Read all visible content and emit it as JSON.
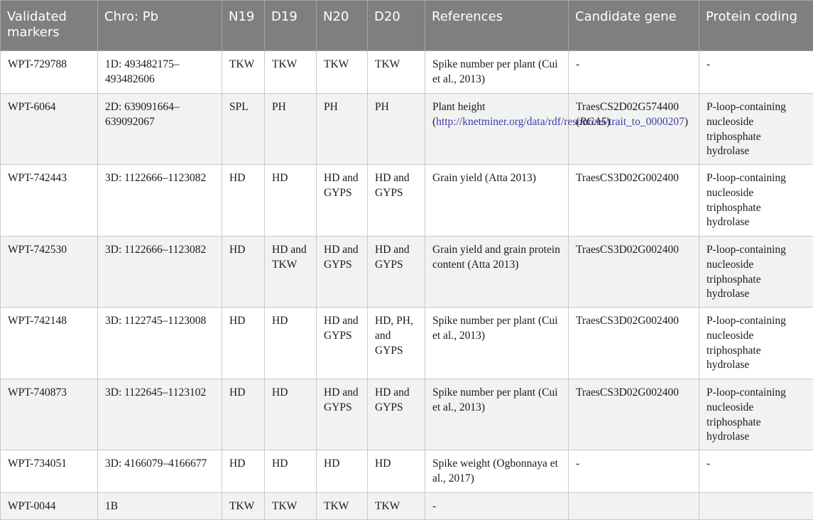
{
  "table": {
    "headers": [
      "Validated markers",
      "Chro: Pb",
      "N19",
      "D19",
      "N20",
      "D20",
      "References",
      "Candidate gene",
      "Protein coding"
    ],
    "rows": [
      {
        "marker": "WPT-729788",
        "chro": "1D: 493482175–493482606",
        "n19": "TKW",
        "d19": "TKW",
        "n20": "TKW",
        "d20": "TKW",
        "reference": "Spike number per plant (Cui et al., 2013)",
        "gene": "-",
        "protein": "-"
      },
      {
        "marker": "WPT-6064",
        "chro": "2D: 639091664–639092067",
        "n19": "SPL",
        "d19": "PH",
        "n20": "PH",
        "d20": "PH",
        "reference_prefix": "Plant height (",
        "reference_link": "http://knetminer.org/data/rdf/resources/trait_to_0000207",
        "reference_suffix": ")",
        "gene": "TraesCS2D02G574400 (",
        "gene_italic": "RGA5",
        "gene_suffix": ")",
        "protein": "P-loop-containing nucleoside triphosphate hydrolase"
      },
      {
        "marker": "WPT-742443",
        "chro": "3D: 1122666–1123082",
        "n19": "HD",
        "d19": "HD",
        "n20": "HD and GYPS",
        "d20": "HD and GYPS",
        "reference": "Grain yield (Atta 2013)",
        "gene": "TraesCS3D02G002400",
        "protein": "P-loop-containing nucleoside triphosphate hydrolase"
      },
      {
        "marker": "WPT-742530",
        "chro": "3D: 1122666–1123082",
        "n19": "HD",
        "d19": "HD and TKW",
        "n20": "HD and GYPS",
        "d20": "HD and GYPS",
        "reference": "Grain yield and grain protein content (Atta 2013)",
        "gene": "TraesCS3D02G002400",
        "protein": "P-loop-containing nucleoside triphosphate hydrolase"
      },
      {
        "marker": "WPT-742148",
        "chro": "3D: 1122745–1123008",
        "n19": "HD",
        "d19": "HD",
        "n20": "HD and GYPS",
        "d20": "HD, PH, and GYPS",
        "reference": "Spike number per plant (Cui et al., 2013)",
        "gene": "TraesCS3D02G002400",
        "protein": "P-loop-containing nucleoside triphosphate hydrolase"
      },
      {
        "marker": "WPT-740873",
        "chro": "3D: 1122645–1123102",
        "n19": "HD",
        "d19": "HD",
        "n20": "HD and GYPS",
        "d20": "HD and GYPS",
        "reference": "Spike number per plant (Cui et al., 2013)",
        "gene": "TraesCS3D02G002400",
        "protein": "P-loop-containing nucleoside triphosphate hydrolase"
      },
      {
        "marker": "WPT-734051",
        "chro": "3D: 4166079–4166677",
        "n19": "HD",
        "d19": "HD",
        "n20": "HD",
        "d20": "HD",
        "reference": "Spike weight (Ogbonnaya et al., 2017)",
        "gene": "-",
        "protein": "-"
      },
      {
        "marker": "WPT-0044",
        "chro": "1B",
        "n19": "TKW",
        "d19": "TKW",
        "n20": "TKW",
        "d20": "TKW",
        "reference": "-",
        "gene": "",
        "protein": ""
      }
    ]
  }
}
